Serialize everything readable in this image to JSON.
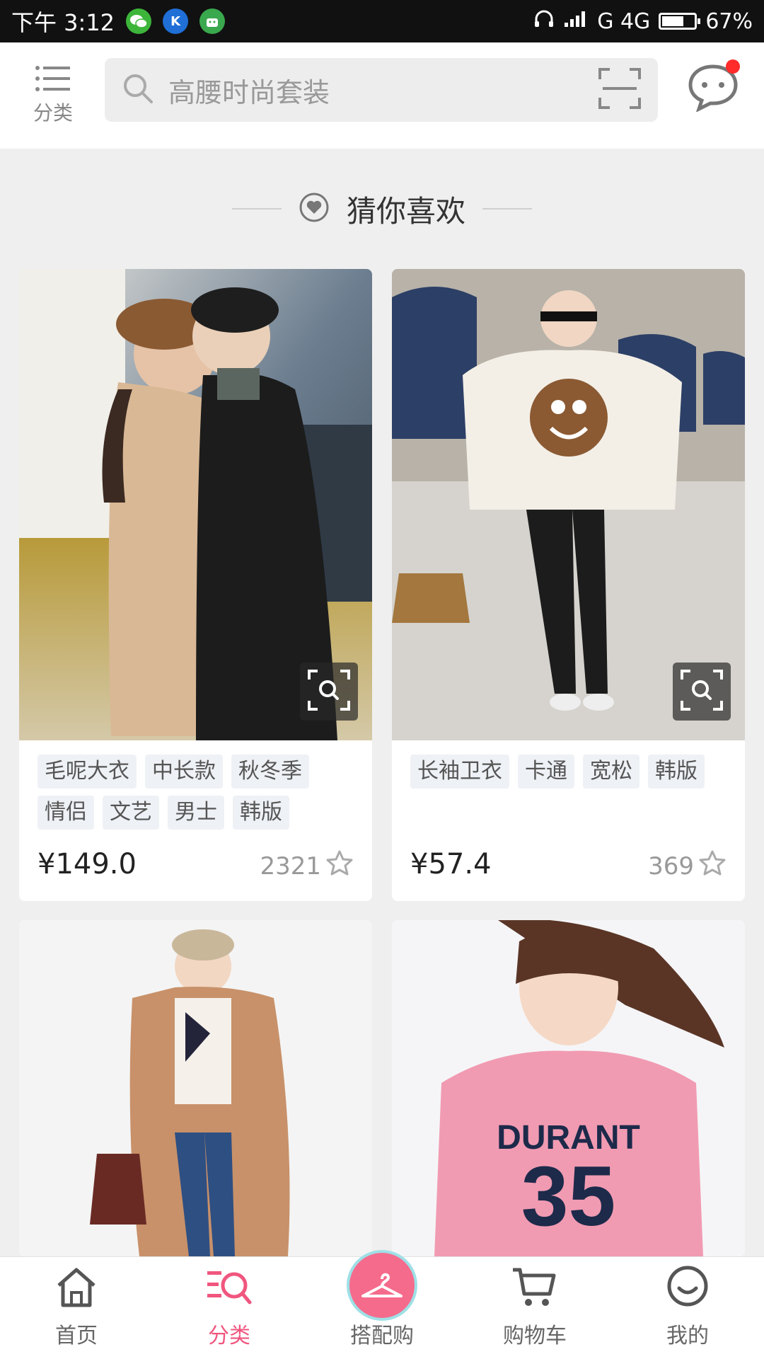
{
  "status_bar": {
    "time": "下午 3:12",
    "network": "G 4G",
    "battery": "67%",
    "battery_level": 0.67
  },
  "header": {
    "category_label": "分类",
    "search_placeholder": "高腰时尚套装"
  },
  "section": {
    "title": "猜你喜欢"
  },
  "products": [
    {
      "tags": [
        "毛呢大衣",
        "中长款",
        "秋冬季",
        "情侣",
        "文艺",
        "男士",
        "韩版"
      ],
      "price": "¥149.0",
      "likes": "2321"
    },
    {
      "tags": [
        "长袖卫衣",
        "卡通",
        "宽松",
        "韩版"
      ],
      "price": "¥57.4",
      "likes": "369"
    },
    {
      "image_text_1": "DURANT",
      "image_text_2": "35"
    }
  ],
  "nav": {
    "items": [
      {
        "label": "首页",
        "icon": "home-icon"
      },
      {
        "label": "分类",
        "icon": "category-search-icon",
        "active": true
      },
      {
        "label": "搭配购",
        "icon": "hanger-icon"
      },
      {
        "label": "购物车",
        "icon": "cart-icon"
      },
      {
        "label": "我的",
        "icon": "profile-icon"
      }
    ]
  },
  "colors": {
    "accent": "#f0567e",
    "status_bar": "#111111",
    "background": "#efefef"
  }
}
